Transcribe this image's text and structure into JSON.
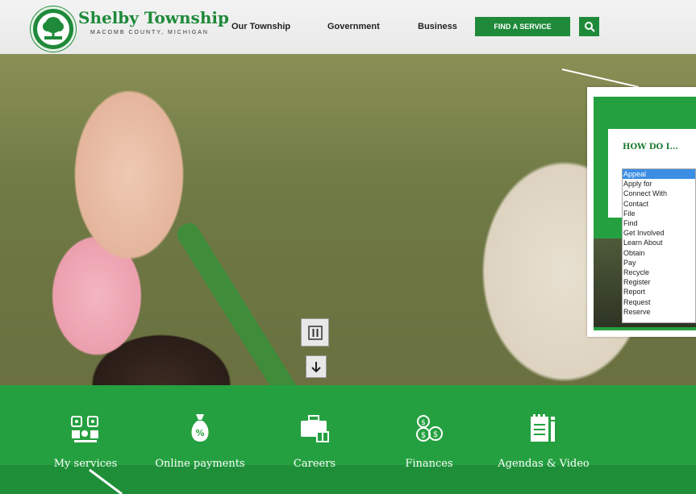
{
  "header": {
    "logo_name": "Shelby Township",
    "logo_sub": "MACOMB COUNTY, MICHIGAN",
    "nav": [
      "Our Township",
      "Government",
      "Business"
    ],
    "find_service": "FIND A SERVICE"
  },
  "hero": {
    "pause_icon": "pause-icon",
    "down_icon": "arrow-down-icon"
  },
  "quicklinks": [
    {
      "label": "My services",
      "icon": "services-icon"
    },
    {
      "label": "Online payments",
      "icon": "money-bag-icon"
    },
    {
      "label": "Careers",
      "icon": "briefcase-icon"
    },
    {
      "label": "Finances",
      "icon": "coins-icon"
    },
    {
      "label": "Agendas & Video",
      "icon": "document-icon"
    }
  ],
  "howdoi": {
    "title": "HOW DO I...",
    "options": [
      "Appeal",
      "Apply for",
      "Connect With",
      "Contact",
      "File",
      "Find",
      "Get Involved",
      "Learn About",
      "Obtain",
      "Pay",
      "Recycle",
      "Register",
      "Report",
      "Request",
      "Reserve"
    ],
    "selected": "Appeal"
  },
  "colors": {
    "brand_green": "#1f8a3a",
    "band_green": "#25a040",
    "select_blue": "#3b8ee4"
  }
}
